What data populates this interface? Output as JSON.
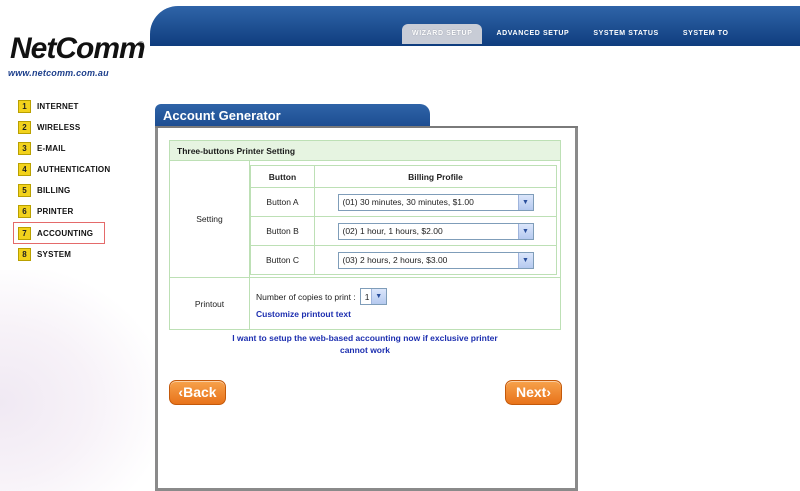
{
  "header": {
    "logo_text": "NetComm",
    "logo_reg": "®",
    "logo_url": "www.netcomm.com.au",
    "tabs": [
      {
        "label": "WIZARD SETUP"
      },
      {
        "label": "ADVANCED SETUP"
      },
      {
        "label": "SYSTEM STATUS"
      },
      {
        "label": "SYSTEM TO"
      }
    ]
  },
  "sidebar": {
    "items": [
      {
        "num": "1",
        "label": "INTERNET"
      },
      {
        "num": "2",
        "label": "WIRELESS"
      },
      {
        "num": "3",
        "label": "E-MAIL"
      },
      {
        "num": "4",
        "label": "AUTHENTICATION"
      },
      {
        "num": "5",
        "label": "BILLING"
      },
      {
        "num": "6",
        "label": "PRINTER"
      },
      {
        "num": "7",
        "label": "ACCOUNTING"
      },
      {
        "num": "8",
        "label": "SYSTEM"
      }
    ],
    "active_index": 6
  },
  "panel": {
    "title": "Account Generator",
    "section_title": "Three-buttons Printer Setting",
    "setting_label": "Setting",
    "col_button": "Button",
    "col_billing": "Billing Profile",
    "rows": [
      {
        "button": "Button A",
        "profile": "(01) 30 minutes, 30 minutes, $1.00"
      },
      {
        "button": "Button B",
        "profile": "(02) 1 hour, 1 hours, $2.00"
      },
      {
        "button": "Button C",
        "profile": "(03) 2 hours, 2 hours, $3.00"
      }
    ],
    "printout_label": "Printout",
    "copies_label": "Number of copies to print :",
    "copies_value": "1",
    "customize_link": "Customize printout text",
    "web_link_line1": "I want to setup the web-based accounting now if exclusive printer",
    "web_link_line2": "cannot work",
    "back_label": "Back",
    "next_label": "Next"
  },
  "colors": {
    "accent_blue": "#1b4b8f",
    "button_orange": "#e8731a",
    "section_green": "#e6f4e1",
    "sidebar_yellow": "#f2d21c",
    "link_blue": "#1d2fb0"
  }
}
